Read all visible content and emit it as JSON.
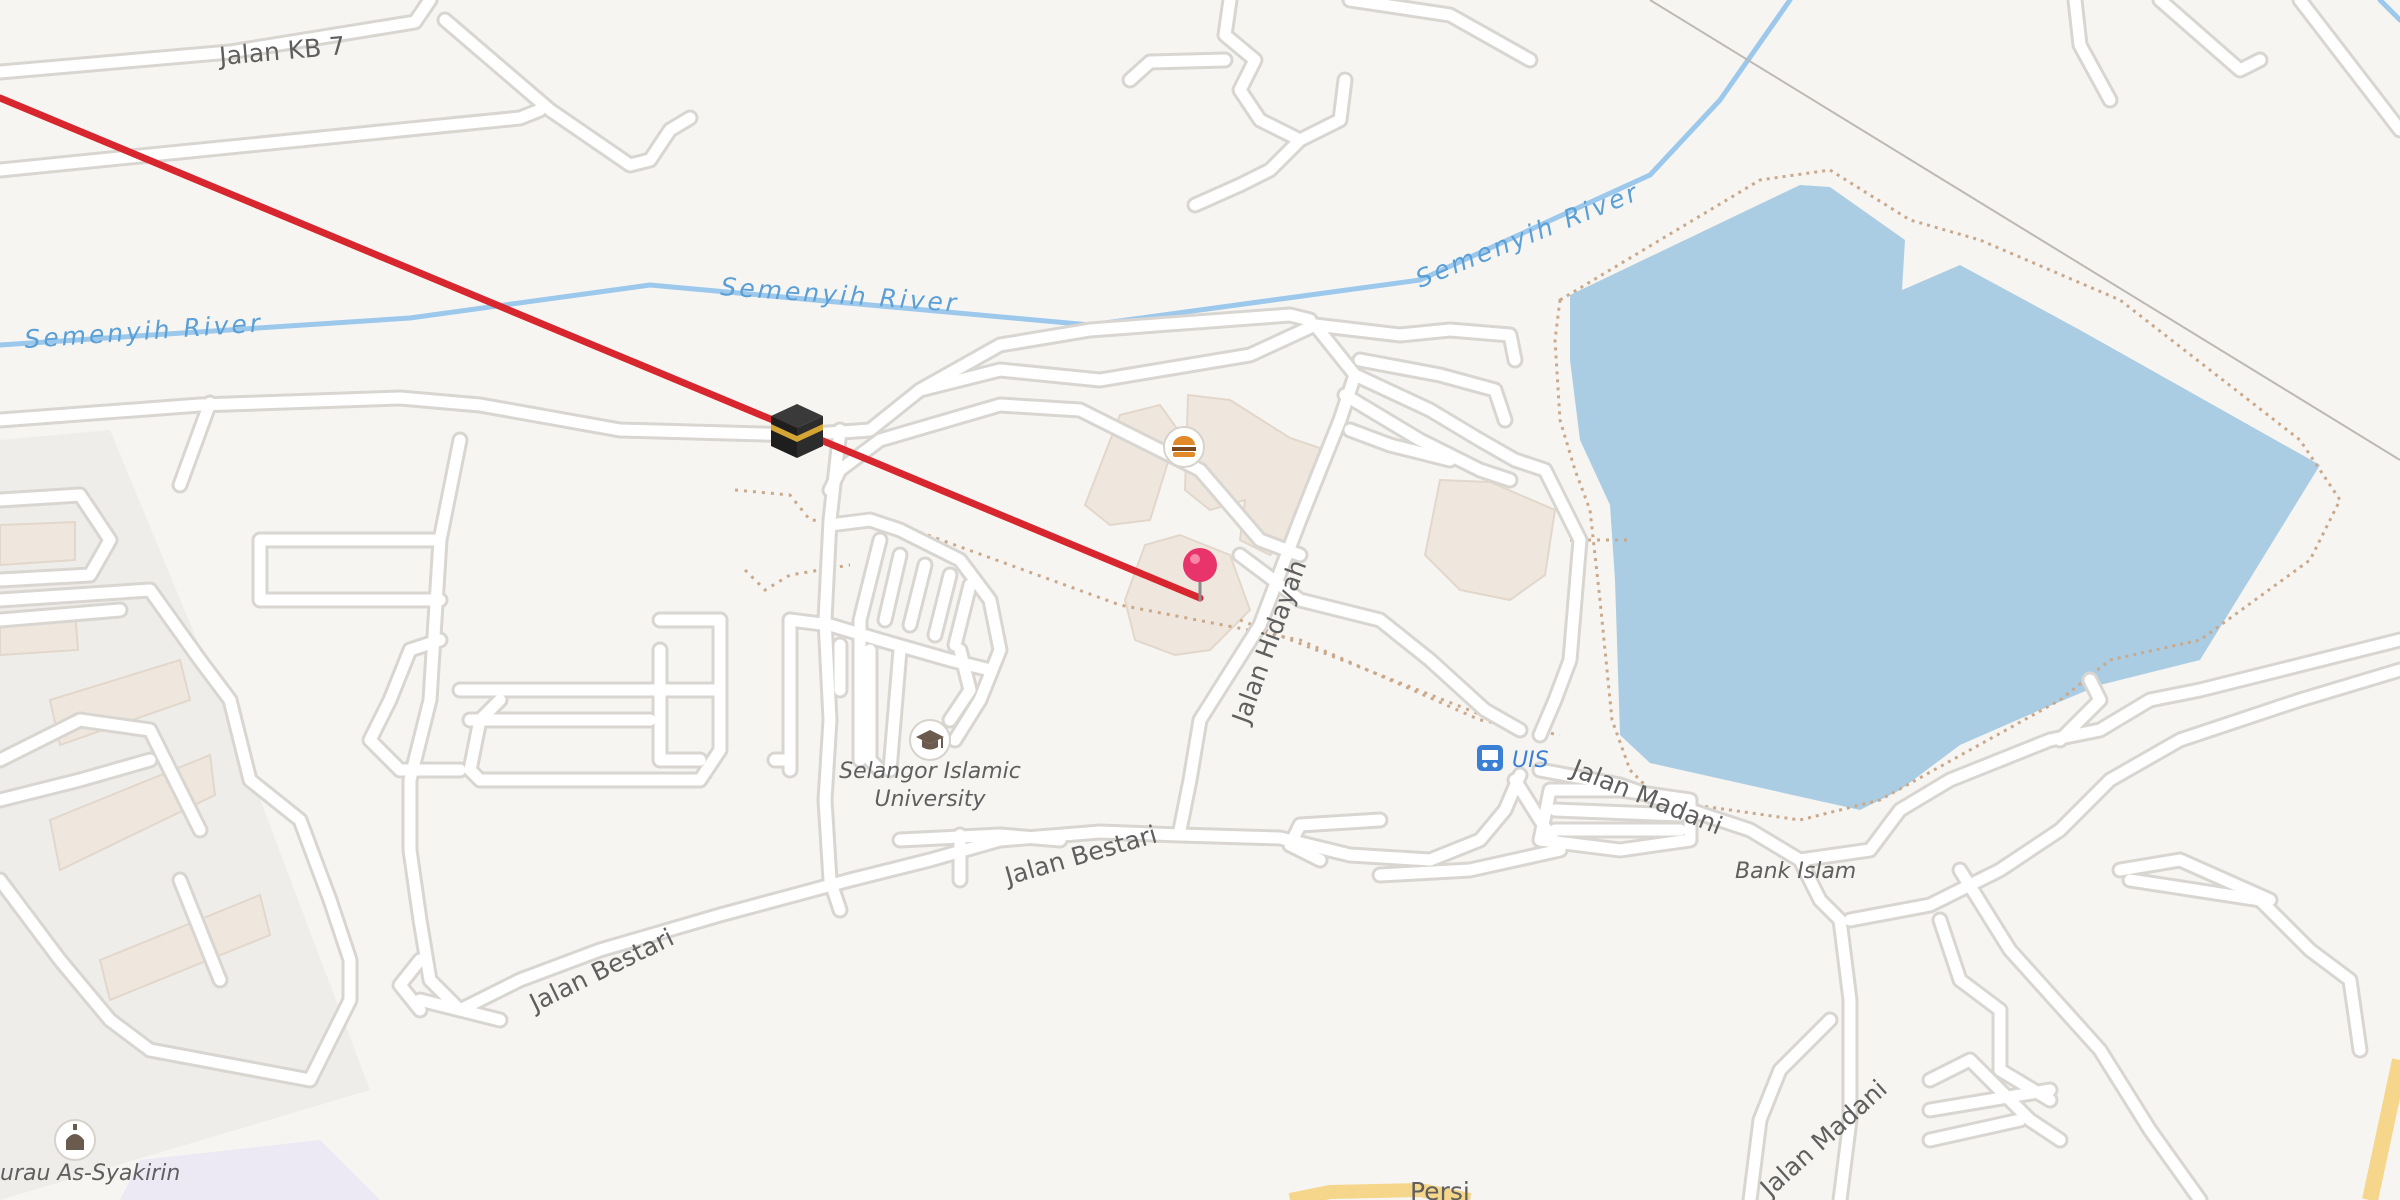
{
  "map": {
    "colors": {
      "land": "#f7f5f2",
      "road_fill": "#ffffff",
      "road_casing": "#d9d6d2",
      "water": "#abcde3",
      "river": "#9cc8ec",
      "building": "#efe6dd",
      "route_line": "#d8262e",
      "pin": "#e8336b",
      "highway": "#f5d68a"
    },
    "road_labels": {
      "jalan_kb7": "Jalan KB 7",
      "jalan_hidayah": "Jalan Hidayah",
      "jalan_madani": "Jalan Madani",
      "jalan_madani_2": "Jalan Madani",
      "jalan_bestari": "Jalan Bestari",
      "jalan_bestari_2": "Jalan Bestari",
      "persiaran_partial": "Persi"
    },
    "river_labels": {
      "river_west": "Semenyih River",
      "river_mid": "Semenyih River",
      "river_east": "Semenyih River"
    },
    "poi_labels": {
      "university_line1": "Selangor Islamic",
      "university_line2": "University",
      "bus_stop": "UIS",
      "bank": "Bank Islam",
      "surau": "urau As-Syakirin"
    },
    "icons": {
      "kaaba": "kaaba-icon",
      "fast_food": "burger-icon",
      "university": "graduation-cap-icon",
      "bus_stop": "bus-icon",
      "mosque": "mosque-icon",
      "pin": "location-pin-icon"
    }
  }
}
